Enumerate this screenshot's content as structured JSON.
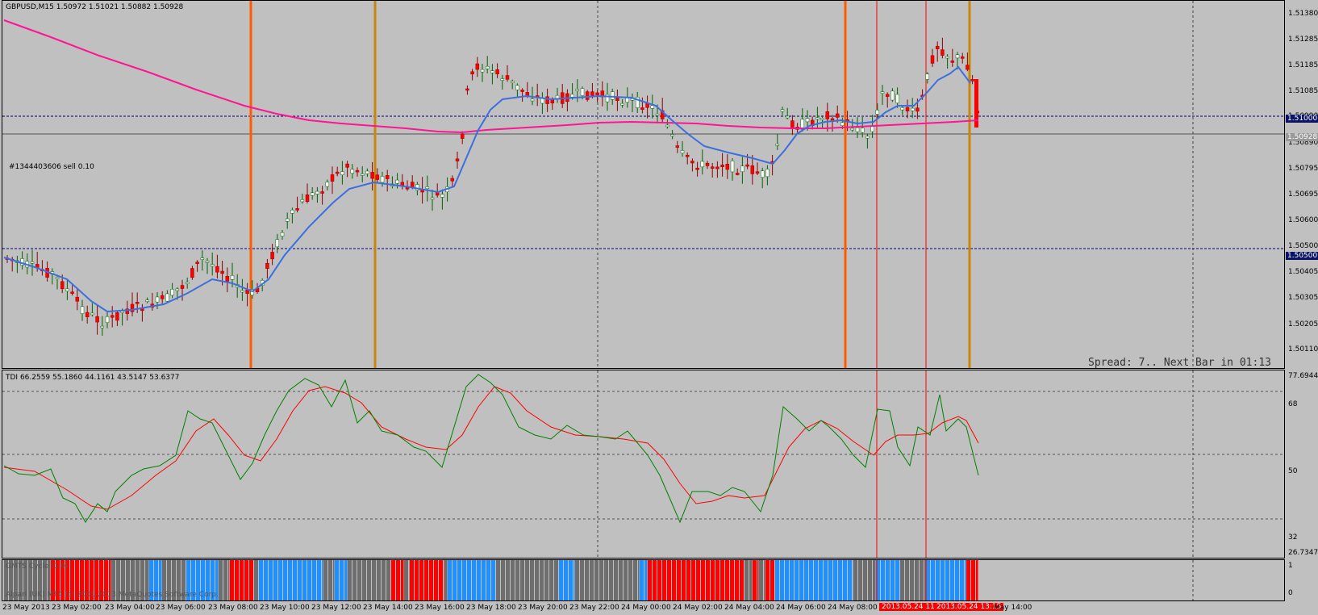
{
  "main": {
    "header": "GBPUSD,M15  1.50972 1.51021 1.50882 1.50928",
    "order_label": "#1344403606 sell 0.10",
    "status": "Spread: 7.. Next Bar in 01:13",
    "price_ticks": [
      "1.51380",
      "1.51285",
      "1.51185",
      "1.51085",
      "1.50990",
      "1.50890",
      "1.50795",
      "1.50695",
      "1.50600",
      "1.50500",
      "1.50405",
      "1.50305",
      "1.50205",
      "1.50110"
    ],
    "level_tags": {
      "upper": "1.51000",
      "current": "1.50928",
      "lower": "1.50500"
    },
    "colors": {
      "bull_candle": "#ffffff",
      "bear_candle": "#ff0000",
      "wick_up": "#006400",
      "ma_fast": "#3b6fe0",
      "ma_slow": "#ff1493",
      "vline_orange": "#ff5a00",
      "vline_gold": "#c8860a",
      "level_line": "#000080"
    }
  },
  "tdi": {
    "header": "TDI 66.2559 55.1860 44.1161 43.5147 53.6377",
    "ticks": [
      "77.6944",
      "68",
      "50",
      "32",
      "26.7347"
    ],
    "colors": {
      "fast": "#008000",
      "slow": "#ff0000"
    }
  },
  "gmts": {
    "header": "GMTS Cycle (1.0)",
    "footer": "Alpari (UK) MT4 (c) 2001-2013 MetaQuotes Software Corp.",
    "ticks": [
      "1",
      "0"
    ],
    "colors": {
      "up": "#1e90ff",
      "down": "#ff0000",
      "neutral": "#6e6e6e"
    }
  },
  "time_labels": [
    "23 May 2013",
    "23 May 02:00",
    "23 May 04:00",
    "23 May 06:00",
    "23 May 08:00",
    "23 May 10:00",
    "23 May 12:00",
    "23 May 14:00",
    "23 May 16:00",
    "23 May 18:00",
    "23 May 20:00",
    "23 May 22:00",
    "24 May 00:00",
    "24 May 02:00",
    "24 May 04:00",
    "24 May 06:00",
    "24 May 08:00",
    "2013.05.24 11",
    "2013.05.24 13:15",
    "May 14:00"
  ]
}
